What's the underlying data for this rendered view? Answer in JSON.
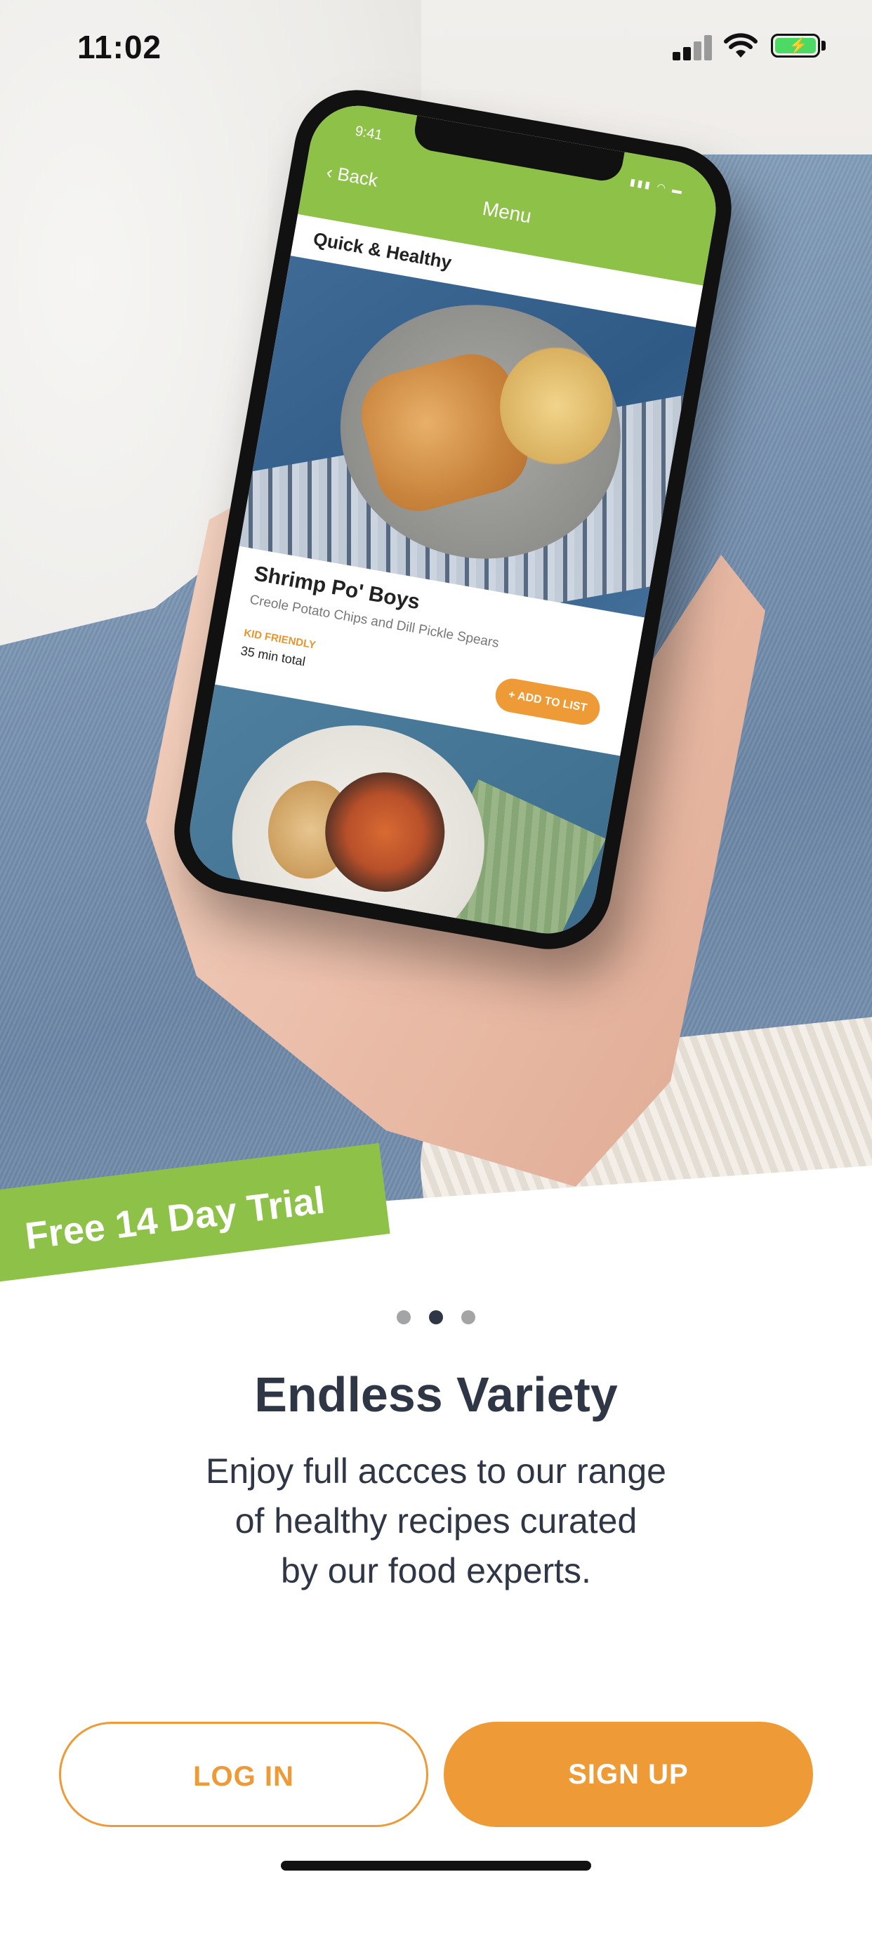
{
  "status_bar": {
    "time": "11:02",
    "icons": [
      "signal-icon",
      "wifi-icon",
      "battery-charging-icon"
    ]
  },
  "hero": {
    "phone_mock": {
      "time": "9:41",
      "back_label": "Back",
      "title": "Menu",
      "section": "Quick & Healthy",
      "card": {
        "dish": "Shrimp Po' Boys",
        "side": "Creole Potato Chips and Dill Pickle Spears",
        "tag": "KID FRIENDLY",
        "duration": "35 min total",
        "add_label": "+ ADD TO LIST"
      }
    }
  },
  "promo": {
    "ribbon": "Free 14 Day Trial"
  },
  "pager": {
    "count": 3,
    "active_index": 1
  },
  "content": {
    "headline": "Endless Variety",
    "line1": "Enjoy full accces to our range",
    "line2": "of healthy recipes curated",
    "line3": "by our food experts."
  },
  "actions": {
    "login": "LOG IN",
    "signup": "SIGN UP"
  },
  "colors": {
    "brand_green": "#8dc148",
    "brand_orange": "#ee9a36",
    "text_dark": "#2f3747",
    "dot_inactive": "#a3a4a6"
  }
}
